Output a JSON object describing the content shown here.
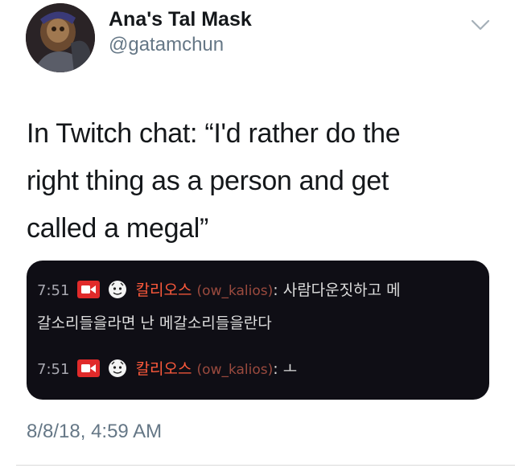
{
  "author": {
    "display_name": "Ana's Tal Mask",
    "handle": "@gatamchun"
  },
  "tweet": {
    "lines": [
      "In Twitch chat: “I'd rather do the",
      "right thing as a person and get",
      "called a megal”"
    ],
    "timestamp": "8/8/18, 4:59 AM"
  },
  "chat": {
    "messages": [
      {
        "time": "7:51",
        "username": "칼리오스",
        "login": "(ow_kalios)",
        "message_line1": ": 사람다운짓하고 메",
        "message_line2": "갈소리들을라면 난 메갈소리들을란다"
      },
      {
        "time": "7:51",
        "username": "칼리오스",
        "login": "(ow_kalios)",
        "message_line1": ": ㅗ"
      }
    ]
  },
  "icons": {
    "menu": "chevron-down-icon",
    "badge1": "video-badge-icon",
    "badge2": "face-badge-icon"
  },
  "colors": {
    "text": "#14171a",
    "secondary": "#657786",
    "chat_bg": "#0f0e15",
    "chat_username": "#ff5a3c",
    "badge_red": "#e02a2a"
  }
}
